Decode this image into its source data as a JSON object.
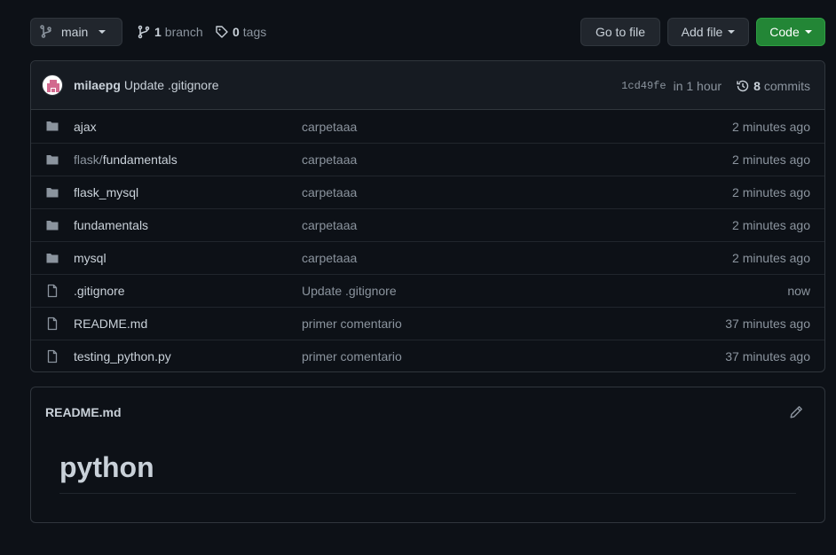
{
  "top_bar": {
    "branch_button": {
      "label": "main",
      "icon": "git-branch-icon"
    },
    "branches": {
      "count": "1",
      "label": "branch",
      "icon": "git-branch-icon"
    },
    "tags": {
      "count": "0",
      "label": "tags",
      "icon": "tag-icon"
    },
    "goto_file_label": "Go to file",
    "add_file_label": "Add file",
    "code_label": "Code"
  },
  "latest_commit": {
    "author": "milaepg",
    "message": "Update .gitignore",
    "sha": "1cd49fe",
    "time": "in 1 hour",
    "commits_count": "8",
    "commits_label": "commits"
  },
  "files": [
    {
      "type": "folder",
      "prefix": "",
      "name": "ajax",
      "commit": "carpetaaa",
      "age": "2 minutes ago"
    },
    {
      "type": "folder",
      "prefix": "flask/",
      "name": "fundamentals",
      "commit": "carpetaaa",
      "age": "2 minutes ago"
    },
    {
      "type": "folder",
      "prefix": "",
      "name": "flask_mysql",
      "commit": "carpetaaa",
      "age": "2 minutes ago"
    },
    {
      "type": "folder",
      "prefix": "",
      "name": "fundamentals",
      "commit": "carpetaaa",
      "age": "2 minutes ago"
    },
    {
      "type": "folder",
      "prefix": "",
      "name": "mysql",
      "commit": "carpetaaa",
      "age": "2 minutes ago"
    },
    {
      "type": "file",
      "prefix": "",
      "name": ".gitignore",
      "commit": "Update .gitignore",
      "age": "now"
    },
    {
      "type": "file",
      "prefix": "",
      "name": "README.md",
      "commit": "primer comentario",
      "age": "37 minutes ago"
    },
    {
      "type": "file",
      "prefix": "",
      "name": "testing_python.py",
      "commit": "primer comentario",
      "age": "37 minutes ago"
    }
  ],
  "readme": {
    "title": "README.md",
    "heading": "python",
    "edit_icon": "pencil-icon"
  },
  "colors": {
    "background": "#0d1117",
    "border": "#30363d",
    "text": "#c9d1d9",
    "muted": "#8b949e",
    "code_button": "#238636",
    "folder_icon": "#8b949e"
  }
}
